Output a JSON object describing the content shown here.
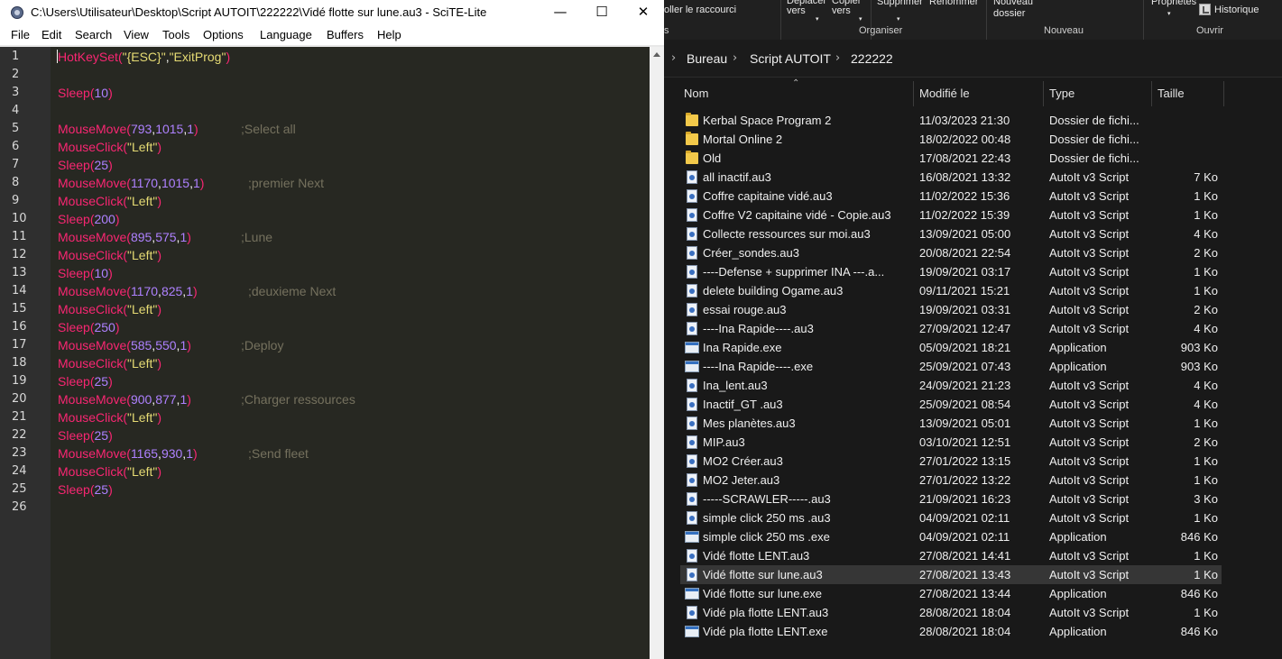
{
  "scite": {
    "title": "C:\\Users\\Utilisateur\\Desktop\\Script AUTOIT\\222222\\Vidé flotte sur lune.au3 - SciTE-Lite",
    "window_controls": {
      "minimize": "—",
      "maximize": "☐",
      "close": "✕"
    },
    "menu": [
      "File",
      "Edit",
      "Search",
      "View",
      "Tools",
      "Options",
      "Language",
      "Buffers",
      "Help"
    ],
    "line_numbers": [
      "1",
      "2",
      "3",
      "4",
      "5",
      "6",
      "7",
      "8",
      "9",
      "10",
      "11",
      "12",
      "13",
      "14",
      "15",
      "16",
      "17",
      "18",
      "19",
      "20",
      "21",
      "22",
      "23",
      "24",
      "25",
      "26"
    ],
    "code": [
      {
        "line": 1,
        "fn": "HotKeySet",
        "open": "(",
        "args": [
          {
            "k": "str",
            "t": "\"{ESC}\""
          },
          {
            "k": "pun",
            "t": ","
          },
          {
            "k": "str",
            "t": "\"ExitProg\""
          }
        ],
        "close": ")",
        "comment": ""
      },
      {
        "line": 2
      },
      {
        "line": 3,
        "fn": "Sleep",
        "open": "(",
        "args": [
          {
            "k": "num",
            "t": "10"
          }
        ],
        "close": ")",
        "comment": ""
      },
      {
        "line": 4
      },
      {
        "line": 5,
        "fn": "MouseMove",
        "open": "(",
        "args": [
          {
            "k": "num",
            "t": "793"
          },
          {
            "k": "pun",
            "t": ","
          },
          {
            "k": "num",
            "t": "1015"
          },
          {
            "k": "pun",
            "t": ","
          },
          {
            "k": "num",
            "t": "1"
          }
        ],
        "close": ")",
        "comment": ";Select all"
      },
      {
        "line": 6,
        "fn": "MouseClick",
        "open": "(",
        "args": [
          {
            "k": "str",
            "t": "\"Left\""
          }
        ],
        "close": ")",
        "comment": ""
      },
      {
        "line": 7,
        "fn": "Sleep",
        "open": "(",
        "args": [
          {
            "k": "num",
            "t": "25"
          }
        ],
        "close": ")",
        "comment": ""
      },
      {
        "line": 8,
        "fn": "MouseMove",
        "open": "(",
        "args": [
          {
            "k": "num",
            "t": "1170"
          },
          {
            "k": "pun",
            "t": ","
          },
          {
            "k": "num",
            "t": "1015"
          },
          {
            "k": "pun",
            "t": ","
          },
          {
            "k": "num",
            "t": "1"
          }
        ],
        "close": ")",
        "comment": ";premier Next"
      },
      {
        "line": 9,
        "fn": "MouseClick",
        "open": "(",
        "args": [
          {
            "k": "str",
            "t": "\"Left\""
          }
        ],
        "close": ")",
        "comment": ""
      },
      {
        "line": 10,
        "fn": "Sleep",
        "open": "(",
        "args": [
          {
            "k": "num",
            "t": "200"
          }
        ],
        "close": ")",
        "comment": ""
      },
      {
        "line": 11,
        "fn": "MouseMove",
        "open": "(",
        "args": [
          {
            "k": "num",
            "t": "895"
          },
          {
            "k": "pun",
            "t": ","
          },
          {
            "k": "num",
            "t": "575"
          },
          {
            "k": "pun",
            "t": ","
          },
          {
            "k": "num",
            "t": "1"
          }
        ],
        "close": ")",
        "comment": ";Lune"
      },
      {
        "line": 12,
        "fn": "MouseClick",
        "open": "(",
        "args": [
          {
            "k": "str",
            "t": "\"Left\""
          }
        ],
        "close": ")",
        "comment": ""
      },
      {
        "line": 13,
        "fn": "Sleep",
        "open": "(",
        "args": [
          {
            "k": "num",
            "t": "10"
          }
        ],
        "close": ")",
        "comment": ""
      },
      {
        "line": 14,
        "fn": "MouseMove",
        "open": "(",
        "args": [
          {
            "k": "num",
            "t": "1170"
          },
          {
            "k": "pun",
            "t": ","
          },
          {
            "k": "num",
            "t": "825"
          },
          {
            "k": "pun",
            "t": ","
          },
          {
            "k": "num",
            "t": "1"
          }
        ],
        "close": ")",
        "comment": ";deuxieme Next"
      },
      {
        "line": 15,
        "fn": "MouseClick",
        "open": "(",
        "args": [
          {
            "k": "str",
            "t": "\"Left\""
          }
        ],
        "close": ")",
        "comment": ""
      },
      {
        "line": 16,
        "fn": "Sleep",
        "open": "(",
        "args": [
          {
            "k": "num",
            "t": "250"
          }
        ],
        "close": ")",
        "comment": ""
      },
      {
        "line": 17,
        "fn": "MouseMove",
        "open": "(",
        "args": [
          {
            "k": "num",
            "t": "585"
          },
          {
            "k": "pun",
            "t": ","
          },
          {
            "k": "num",
            "t": "550"
          },
          {
            "k": "pun",
            "t": ","
          },
          {
            "k": "num",
            "t": "1"
          }
        ],
        "close": ")",
        "comment": ";Deploy"
      },
      {
        "line": 18,
        "fn": "MouseClick",
        "open": "(",
        "args": [
          {
            "k": "str",
            "t": "\"Left\""
          }
        ],
        "close": ")",
        "comment": ""
      },
      {
        "line": 19,
        "fn": "Sleep",
        "open": "(",
        "args": [
          {
            "k": "num",
            "t": "25"
          }
        ],
        "close": ")",
        "comment": ""
      },
      {
        "line": 20,
        "fn": "MouseMove",
        "open": "(",
        "args": [
          {
            "k": "num",
            "t": "900"
          },
          {
            "k": "pun",
            "t": ","
          },
          {
            "k": "num",
            "t": "877"
          },
          {
            "k": "pun",
            "t": ","
          },
          {
            "k": "num",
            "t": "1"
          }
        ],
        "close": ")",
        "comment": ";Charger ressources"
      },
      {
        "line": 21,
        "fn": "MouseClick",
        "open": "(",
        "args": [
          {
            "k": "str",
            "t": "\"Left\""
          }
        ],
        "close": ")",
        "comment": ""
      },
      {
        "line": 22,
        "fn": "Sleep",
        "open": "(",
        "args": [
          {
            "k": "num",
            "t": "25"
          }
        ],
        "close": ")",
        "comment": ""
      },
      {
        "line": 23,
        "fn": "MouseMove",
        "open": "(",
        "args": [
          {
            "k": "num",
            "t": "1165"
          },
          {
            "k": "pun",
            "t": ","
          },
          {
            "k": "num",
            "t": "930"
          },
          {
            "k": "pun",
            "t": ","
          },
          {
            "k": "num",
            "t": "1"
          }
        ],
        "close": ")",
        "comment": ";Send fleet"
      },
      {
        "line": 24,
        "fn": "MouseClick",
        "open": "(",
        "args": [
          {
            "k": "str",
            "t": "\"Left\""
          }
        ],
        "close": ")",
        "comment": ""
      },
      {
        "line": 25,
        "fn": "Sleep",
        "open": "(",
        "args": [
          {
            "k": "num",
            "t": "25"
          }
        ],
        "close": ")",
        "comment": ""
      },
      {
        "line": 26
      }
    ],
    "colors": {
      "background": "#272822",
      "function": "#f92672",
      "string": "#e6db74",
      "number": "#ae81ff",
      "comment": "#75715e"
    }
  },
  "explorer": {
    "ribbon": {
      "copy_shortcut": "oller le raccourci",
      "move_to": "Déplacer\nvers",
      "copy_to": "Copier\nvers",
      "delete": "Supprimer",
      "rename": "Renommer",
      "new_folder": "Nouveau\ndossier",
      "properties": "Propriétés",
      "history": "Historique",
      "groups": {
        "organize": "Organiser",
        "new": "Nouveau",
        "open": "Ouvrir"
      }
    },
    "breadcrumb": [
      "Bureau",
      "Script AUTOIT",
      "222222"
    ],
    "columns": {
      "name": "Nom",
      "modified": "Modifié le",
      "type": "Type",
      "size": "Taille"
    },
    "files": [
      {
        "icon": "folder-icon",
        "name": "Kerbal Space Program 2",
        "modified": "11/03/2023 21:30",
        "type": "Dossier de fichi...",
        "size": ""
      },
      {
        "icon": "folder-icon",
        "name": "Mortal Online 2",
        "modified": "18/02/2022 00:48",
        "type": "Dossier de fichi...",
        "size": ""
      },
      {
        "icon": "folder-icon",
        "name": "Old",
        "modified": "17/08/2021 22:43",
        "type": "Dossier de fichi...",
        "size": ""
      },
      {
        "icon": "au3-script-icon",
        "name": "all inactif.au3",
        "modified": "16/08/2021 13:32",
        "type": "AutoIt v3 Script",
        "size": "7 Ko"
      },
      {
        "icon": "au3-script-icon",
        "name": "Coffre capitaine vidé.au3",
        "modified": "11/02/2022 15:36",
        "type": "AutoIt v3 Script",
        "size": "1 Ko"
      },
      {
        "icon": "au3-script-icon",
        "name": "Coffre V2 capitaine vidé - Copie.au3",
        "modified": "11/02/2022 15:39",
        "type": "AutoIt v3 Script",
        "size": "1 Ko"
      },
      {
        "icon": "au3-script-icon",
        "name": "Collecte ressources sur moi.au3",
        "modified": "13/09/2021 05:00",
        "type": "AutoIt v3 Script",
        "size": "4 Ko"
      },
      {
        "icon": "au3-script-icon",
        "name": "Créer_sondes.au3",
        "modified": "20/08/2021 22:54",
        "type": "AutoIt v3 Script",
        "size": "2 Ko"
      },
      {
        "icon": "au3-script-icon",
        "name": "----Defense + supprimer INA ---.a...",
        "modified": "19/09/2021 03:17",
        "type": "AutoIt v3 Script",
        "size": "1 Ko"
      },
      {
        "icon": "au3-script-icon",
        "name": "delete building Ogame.au3",
        "modified": "09/11/2021 15:21",
        "type": "AutoIt v3 Script",
        "size": "1 Ko"
      },
      {
        "icon": "au3-script-icon",
        "name": "essai rouge.au3",
        "modified": "19/09/2021 03:31",
        "type": "AutoIt v3 Script",
        "size": "2 Ko"
      },
      {
        "icon": "au3-script-icon",
        "name": "----Ina Rapide----.au3",
        "modified": "27/09/2021 12:47",
        "type": "AutoIt v3 Script",
        "size": "4 Ko"
      },
      {
        "icon": "exe-application-icon",
        "name": "Ina Rapide.exe",
        "modified": "05/09/2021 18:21",
        "type": "Application",
        "size": "903 Ko"
      },
      {
        "icon": "exe-application-icon",
        "name": "----Ina Rapide----.exe",
        "modified": "25/09/2021 07:43",
        "type": "Application",
        "size": "903 Ko"
      },
      {
        "icon": "au3-script-icon",
        "name": "Ina_lent.au3",
        "modified": "24/09/2021 21:23",
        "type": "AutoIt v3 Script",
        "size": "4 Ko"
      },
      {
        "icon": "au3-script-icon",
        "name": "Inactif_GT .au3",
        "modified": "25/09/2021 08:54",
        "type": "AutoIt v3 Script",
        "size": "4 Ko"
      },
      {
        "icon": "au3-script-icon",
        "name": "Mes planètes.au3",
        "modified": "13/09/2021 05:01",
        "type": "AutoIt v3 Script",
        "size": "1 Ko"
      },
      {
        "icon": "au3-script-icon",
        "name": "MIP.au3",
        "modified": "03/10/2021 12:51",
        "type": "AutoIt v3 Script",
        "size": "2 Ko"
      },
      {
        "icon": "au3-script-icon",
        "name": "MO2 Créer.au3",
        "modified": "27/01/2022 13:15",
        "type": "AutoIt v3 Script",
        "size": "1 Ko"
      },
      {
        "icon": "au3-script-icon",
        "name": "MO2 Jeter.au3",
        "modified": "27/01/2022 13:22",
        "type": "AutoIt v3 Script",
        "size": "1 Ko"
      },
      {
        "icon": "au3-script-icon",
        "name": "-----SCRAWLER-----.au3",
        "modified": "21/09/2021 16:23",
        "type": "AutoIt v3 Script",
        "size": "3 Ko"
      },
      {
        "icon": "au3-script-icon",
        "name": "simple click 250 ms .au3",
        "modified": "04/09/2021 02:11",
        "type": "AutoIt v3 Script",
        "size": "1 Ko"
      },
      {
        "icon": "exe-application-icon",
        "name": "simple click 250 ms .exe",
        "modified": "04/09/2021 02:11",
        "type": "Application",
        "size": "846 Ko"
      },
      {
        "icon": "au3-script-icon",
        "name": "Vidé flotte LENT.au3",
        "modified": "27/08/2021 14:41",
        "type": "AutoIt v3 Script",
        "size": "1 Ko"
      },
      {
        "icon": "au3-script-icon",
        "name": "Vidé flotte sur lune.au3",
        "modified": "27/08/2021 13:43",
        "type": "AutoIt v3 Script",
        "size": "1 Ko",
        "selected": true
      },
      {
        "icon": "exe-application-icon",
        "name": "Vidé flotte sur lune.exe",
        "modified": "27/08/2021 13:44",
        "type": "Application",
        "size": "846 Ko"
      },
      {
        "icon": "au3-script-icon",
        "name": "Vidé pla flotte LENT.au3",
        "modified": "28/08/2021 18:04",
        "type": "AutoIt v3 Script",
        "size": "1 Ko"
      },
      {
        "icon": "exe-application-icon",
        "name": "Vidé pla flotte LENT.exe",
        "modified": "28/08/2021 18:04",
        "type": "Application",
        "size": "846 Ko"
      }
    ]
  }
}
